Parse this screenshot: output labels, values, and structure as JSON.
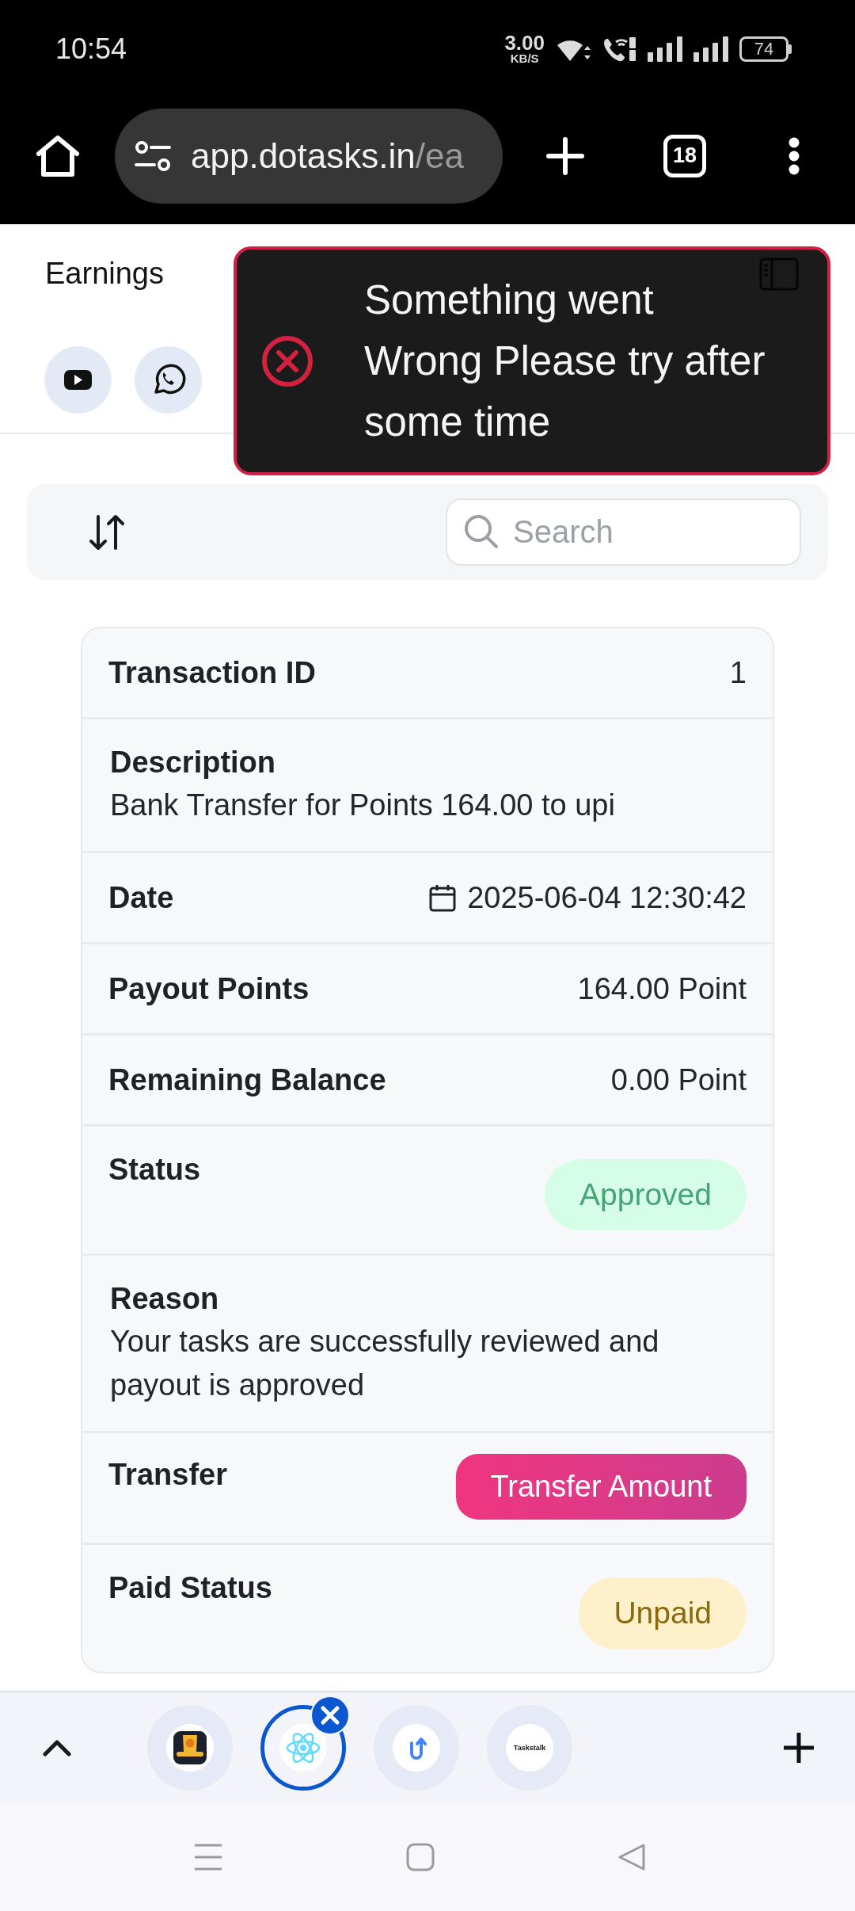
{
  "status_bar": {
    "time": "10:54",
    "net_speed": "3.00",
    "net_unit": "KB/S",
    "battery": "74"
  },
  "browser_bar": {
    "url_host": "app.dotasks.in",
    "url_path": "/ea",
    "tab_count": "18"
  },
  "header": {
    "title": "Earnings"
  },
  "toast": {
    "message": "Something went Wrong Please try after some time"
  },
  "filter_bar": {
    "search": {
      "placeholder": "Search"
    }
  },
  "transaction": {
    "rows": [
      {
        "kind": "inline",
        "label": "Transaction ID",
        "value": "1"
      },
      {
        "kind": "stacked",
        "label": "Description",
        "value": "Bank Transfer for Points 164.00 to upi"
      },
      {
        "kind": "date",
        "label": "Date",
        "value": "2025-06-04 12:30:42"
      },
      {
        "kind": "inline",
        "label": "Payout Points",
        "value": "164.00 Point"
      },
      {
        "kind": "inline",
        "label": "Remaining Balance",
        "value": "0.00 Point"
      },
      {
        "kind": "badge",
        "label": "Status",
        "value": "Approved",
        "color": "#47a378"
      },
      {
        "kind": "stacked",
        "label": "Reason",
        "value": "Your tasks are successfully reviewed and payout is approved"
      },
      {
        "kind": "button",
        "label": "Transfer",
        "value": "Transfer Amount"
      },
      {
        "kind": "badge",
        "label": "Paid Status",
        "value": "Unpaid",
        "color": "#8a6a0e"
      }
    ]
  },
  "tab_strip": {
    "tabs": [
      {
        "selected": false
      },
      {
        "selected": true
      },
      {
        "selected": false
      },
      {
        "selected": false,
        "favicon_text": "Taskstalk"
      }
    ]
  }
}
